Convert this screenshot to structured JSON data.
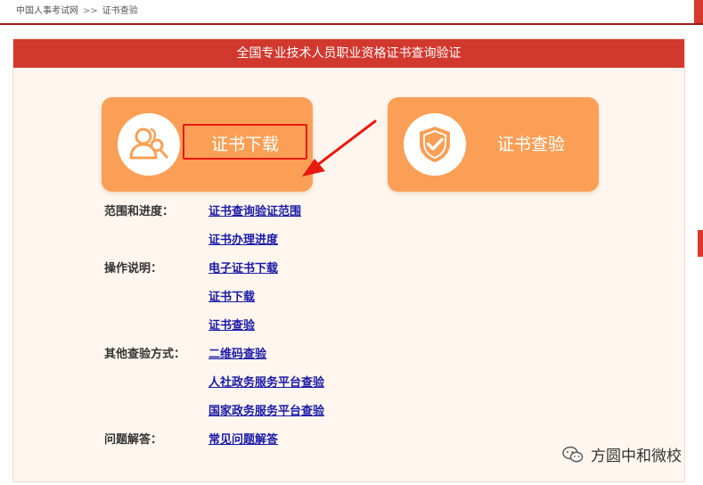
{
  "breadcrumb": {
    "home": "中国人事考试网",
    "separator": ">>",
    "current": "证书查验"
  },
  "panel": {
    "title": "全国专业技术人员职业资格证书查询验证"
  },
  "cards": {
    "download": {
      "label": "证书下载",
      "icon": "user-search-icon"
    },
    "verify": {
      "label": "证书查验",
      "icon": "shield-check-icon"
    }
  },
  "links": {
    "rows": [
      {
        "label": "范围和进度：",
        "link": "证书查询验证范围"
      },
      {
        "label": "",
        "link": "证书办理进度"
      },
      {
        "label": "操作说明：",
        "link": "电子证书下载"
      },
      {
        "label": "",
        "link": "证书下载"
      },
      {
        "label": "",
        "link": "证书查验"
      },
      {
        "label": "其他查验方式：",
        "link": "二维码查验"
      },
      {
        "label": "",
        "link": "人社政务服务平台查验"
      },
      {
        "label": "",
        "link": "国家政务服务平台查验"
      },
      {
        "label": "问题解答：",
        "link": "常见问题解答"
      }
    ]
  },
  "watermark": {
    "text": "方圆中和微校",
    "icon": "wechat-icon"
  },
  "colors": {
    "header_red": "#d1382e",
    "card_orange": "#fb9f56",
    "panel_bg": "#fef6ef",
    "link_blue": "#1a1aa6",
    "highlight_red": "#e8190f"
  }
}
